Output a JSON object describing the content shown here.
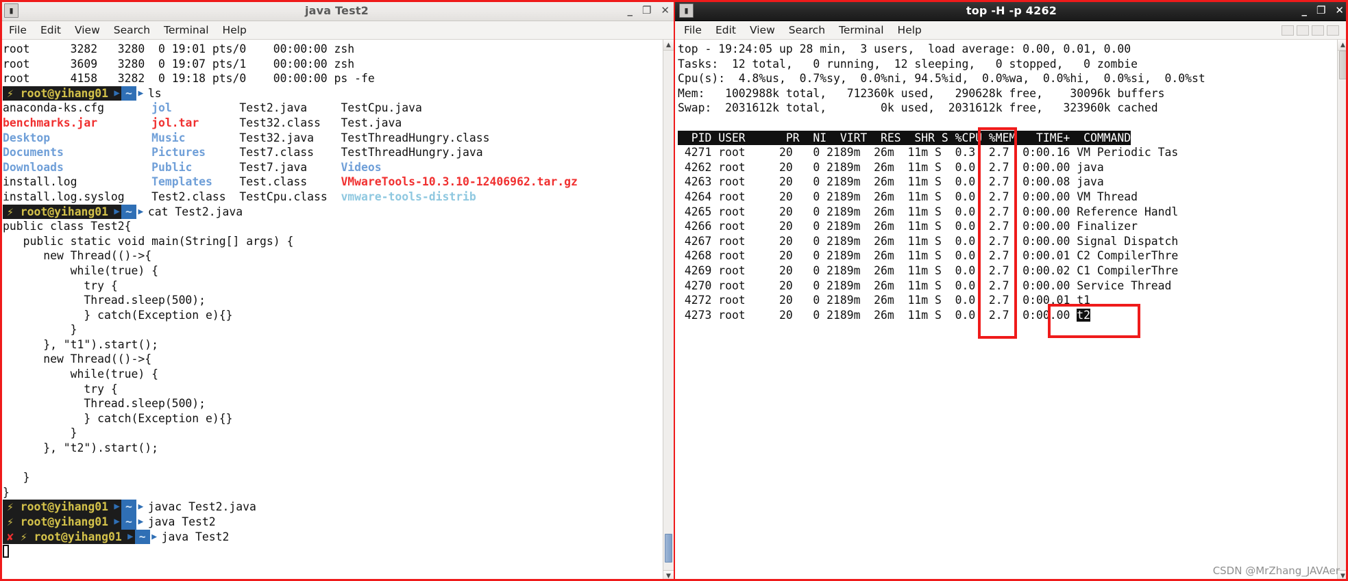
{
  "left_window": {
    "title": "java Test2",
    "icon": "terminal-icon",
    "window_controls": {
      "minimize": "_",
      "maximize": "❐",
      "close": "✕"
    },
    "menu": [
      "File",
      "Edit",
      "View",
      "Search",
      "Terminal",
      "Help"
    ],
    "prompt": {
      "user_host": "root@yihang01",
      "path": "~",
      "ok_glyph": "⚡",
      "err_glyph": "✘",
      "sep_glyph": "⌫"
    },
    "ps_output": [
      "root      3282   3280  0 19:01 pts/0    00:00:00 zsh",
      "root      3609   3280  0 19:07 pts/1    00:00:00 zsh",
      "root      4158   3282  0 19:18 pts/0    00:00:00 ps -fe"
    ],
    "cmd_ls": "ls",
    "ls_rows": [
      [
        {
          "t": "anaconda-ks.cfg",
          "c": "plain"
        },
        {
          "t": "jol",
          "c": "blue"
        },
        {
          "t": "Test2.java",
          "c": "plain"
        },
        {
          "t": "TestCpu.java",
          "c": "plain"
        }
      ],
      [
        {
          "t": "benchmarks.jar",
          "c": "red"
        },
        {
          "t": "jol.tar",
          "c": "red"
        },
        {
          "t": "Test32.class",
          "c": "plain"
        },
        {
          "t": "Test.java",
          "c": "plain"
        }
      ],
      [
        {
          "t": "Desktop",
          "c": "blue"
        },
        {
          "t": "Music",
          "c": "blue"
        },
        {
          "t": "Test32.java",
          "c": "plain"
        },
        {
          "t": "TestThreadHungry.class",
          "c": "plain"
        }
      ],
      [
        {
          "t": "Documents",
          "c": "blue"
        },
        {
          "t": "Pictures",
          "c": "blue"
        },
        {
          "t": "Test7.class",
          "c": "plain"
        },
        {
          "t": "TestThreadHungry.java",
          "c": "plain"
        }
      ],
      [
        {
          "t": "Downloads",
          "c": "blue"
        },
        {
          "t": "Public",
          "c": "blue"
        },
        {
          "t": "Test7.java",
          "c": "plain"
        },
        {
          "t": "Videos",
          "c": "blue"
        }
      ],
      [
        {
          "t": "install.log",
          "c": "plain"
        },
        {
          "t": "Templates",
          "c": "blue"
        },
        {
          "t": "Test.class",
          "c": "plain"
        },
        {
          "t": "VMwareTools-10.3.10-12406962.tar.gz",
          "c": "red"
        }
      ],
      [
        {
          "t": "install.log.syslog",
          "c": "plain"
        },
        {
          "t": "Test2.class",
          "c": "plain"
        },
        {
          "t": "TestCpu.class",
          "c": "plain"
        },
        {
          "t": "vmware-tools-distrib",
          "c": "cyan"
        }
      ]
    ],
    "cmd_cat": "cat Test2.java",
    "source_code": [
      "public class Test2{",
      "   public static void main(String[] args) {",
      "      new Thread(()->{",
      "          while(true) {",
      "            try {",
      "            Thread.sleep(500);",
      "            } catch(Exception e){}",
      "          }",
      "      }, \"t1\").start();",
      "      new Thread(()->{",
      "          while(true) {",
      "            try {",
      "            Thread.sleep(500);",
      "            } catch(Exception e){}",
      "          }",
      "      }, \"t2\").start();",
      "",
      "   }",
      "}"
    ],
    "cmd_javac": "javac Test2.java",
    "cmd_java_1": "java Test2",
    "cmd_java_2": "java Test2"
  },
  "right_window": {
    "title": "top -H -p 4262",
    "icon": "terminal-icon",
    "window_controls": {
      "minimize": "_",
      "maximize": "❐",
      "close": "✕"
    },
    "menu": [
      "File",
      "Edit",
      "View",
      "Search",
      "Terminal",
      "Help"
    ],
    "top_summary": [
      "top - 19:24:05 up 28 min,  3 users,  load average: 0.00, 0.01, 0.00",
      "Tasks:  12 total,   0 running,  12 sleeping,   0 stopped,   0 zombie",
      "Cpu(s):  4.8%us,  0.7%sy,  0.0%ni, 94.5%id,  0.0%wa,  0.0%hi,  0.0%si,  0.0%st",
      "Mem:   1002988k total,   712360k used,   290628k free,    30096k buffers",
      "Swap:  2031612k total,        0k used,  2031612k free,   323960k cached"
    ],
    "table_header": "  PID USER      PR  NI  VIRT  RES  SHR S %CPU %MEM   TIME+  COMMAND",
    "rows": [
      {
        "pid": "4271",
        "user": "root",
        "pr": "20",
        "ni": "0",
        "virt": "2189m",
        "res": "26m",
        "shr": "11m",
        "s": "S",
        "cpu": "0.3",
        "mem": "2.7",
        "time": "0:00.16",
        "command": "VM Periodic Tas",
        "highlight": false
      },
      {
        "pid": "4262",
        "user": "root",
        "pr": "20",
        "ni": "0",
        "virt": "2189m",
        "res": "26m",
        "shr": "11m",
        "s": "S",
        "cpu": "0.0",
        "mem": "2.7",
        "time": "0:00.00",
        "command": "java",
        "highlight": false
      },
      {
        "pid": "4263",
        "user": "root",
        "pr": "20",
        "ni": "0",
        "virt": "2189m",
        "res": "26m",
        "shr": "11m",
        "s": "S",
        "cpu": "0.0",
        "mem": "2.7",
        "time": "0:00.08",
        "command": "java",
        "highlight": false
      },
      {
        "pid": "4264",
        "user": "root",
        "pr": "20",
        "ni": "0",
        "virt": "2189m",
        "res": "26m",
        "shr": "11m",
        "s": "S",
        "cpu": "0.0",
        "mem": "2.7",
        "time": "0:00.00",
        "command": "VM Thread",
        "highlight": false
      },
      {
        "pid": "4265",
        "user": "root",
        "pr": "20",
        "ni": "0",
        "virt": "2189m",
        "res": "26m",
        "shr": "11m",
        "s": "S",
        "cpu": "0.0",
        "mem": "2.7",
        "time": "0:00.00",
        "command": "Reference Handl",
        "highlight": false
      },
      {
        "pid": "4266",
        "user": "root",
        "pr": "20",
        "ni": "0",
        "virt": "2189m",
        "res": "26m",
        "shr": "11m",
        "s": "S",
        "cpu": "0.0",
        "mem": "2.7",
        "time": "0:00.00",
        "command": "Finalizer",
        "highlight": false
      },
      {
        "pid": "4267",
        "user": "root",
        "pr": "20",
        "ni": "0",
        "virt": "2189m",
        "res": "26m",
        "shr": "11m",
        "s": "S",
        "cpu": "0.0",
        "mem": "2.7",
        "time": "0:00.00",
        "command": "Signal Dispatch",
        "highlight": false
      },
      {
        "pid": "4268",
        "user": "root",
        "pr": "20",
        "ni": "0",
        "virt": "2189m",
        "res": "26m",
        "shr": "11m",
        "s": "S",
        "cpu": "0.0",
        "mem": "2.7",
        "time": "0:00.01",
        "command": "C2 CompilerThre",
        "highlight": false
      },
      {
        "pid": "4269",
        "user": "root",
        "pr": "20",
        "ni": "0",
        "virt": "2189m",
        "res": "26m",
        "shr": "11m",
        "s": "S",
        "cpu": "0.0",
        "mem": "2.7",
        "time": "0:00.02",
        "command": "C1 CompilerThre",
        "highlight": false
      },
      {
        "pid": "4270",
        "user": "root",
        "pr": "20",
        "ni": "0",
        "virt": "2189m",
        "res": "26m",
        "shr": "11m",
        "s": "S",
        "cpu": "0.0",
        "mem": "2.7",
        "time": "0:00.00",
        "command": "Service Thread",
        "highlight": false
      },
      {
        "pid": "4272",
        "user": "root",
        "pr": "20",
        "ni": "0",
        "virt": "2189m",
        "res": "26m",
        "shr": "11m",
        "s": "S",
        "cpu": "0.0",
        "mem": "2.7",
        "time": "0:00.01",
        "command": "t1",
        "highlight": false
      },
      {
        "pid": "4273",
        "user": "root",
        "pr": "20",
        "ni": "0",
        "virt": "2189m",
        "res": "26m",
        "shr": "11m",
        "s": "S",
        "cpu": "0.0",
        "mem": "2.7",
        "time": "0:00.00",
        "command": "t2",
        "highlight": true
      }
    ]
  },
  "annotations": {
    "cpu_column_box": "highlight-cpu-column",
    "thread_rows_box": "highlight-t1-t2-rows",
    "outer_box": "screenshot-outline"
  },
  "watermark": "CSDN @MrZhang_JAVAer",
  "colors": {
    "annotation_red": "#ef1b1b",
    "prompt_user_bg": "#1c1c1c",
    "prompt_user_fg": "#d4c24a",
    "prompt_path_bg": "#2f6fb5",
    "dir_blue": "#6f9fd8",
    "archive_red": "#f03030",
    "link_cyan": "#8fc8e0",
    "terminal_bg": "#ffffff",
    "terminal_fg": "#101010"
  }
}
